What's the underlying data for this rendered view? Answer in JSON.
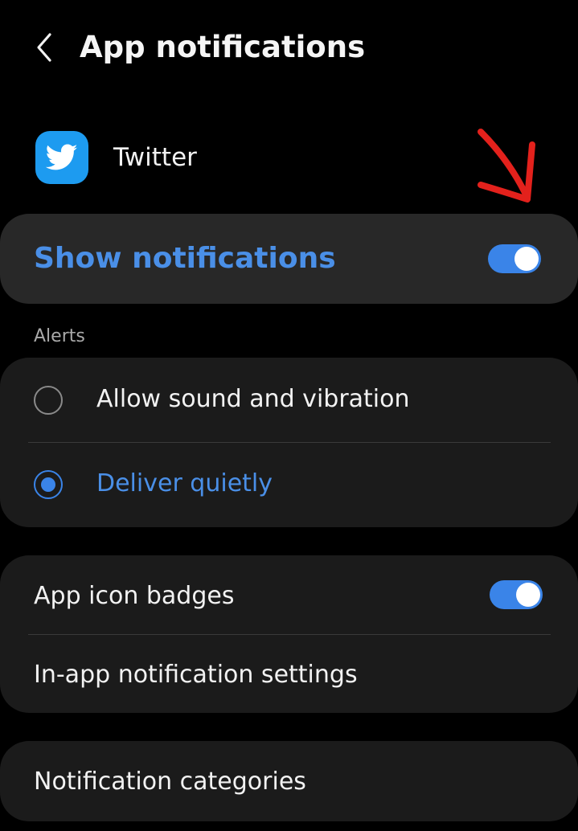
{
  "header": {
    "title": "App notifications",
    "back_icon": "chevron-left-icon"
  },
  "app": {
    "name": "Twitter",
    "icon": "twitter-bird-icon",
    "icon_color": "#1d9bf0"
  },
  "show_notifications": {
    "label": "Show notifications",
    "enabled": true
  },
  "alerts": {
    "section_label": "Alerts",
    "options": [
      {
        "label": "Allow sound and vibration",
        "selected": false
      },
      {
        "label": "Deliver quietly",
        "selected": true
      }
    ]
  },
  "badges_group": {
    "app_icon_badges": {
      "label": "App icon badges",
      "enabled": true
    },
    "in_app_settings": {
      "label": "In-app notification settings"
    }
  },
  "categories": {
    "label": "Notification categories"
  },
  "annotation": {
    "icon": "red-arrow-annotation-icon",
    "color": "#e3211c"
  },
  "colors": {
    "accent": "#3a84e8",
    "accent_text": "#4a8fe7",
    "background": "#000000",
    "card": "#1b1b1b"
  }
}
